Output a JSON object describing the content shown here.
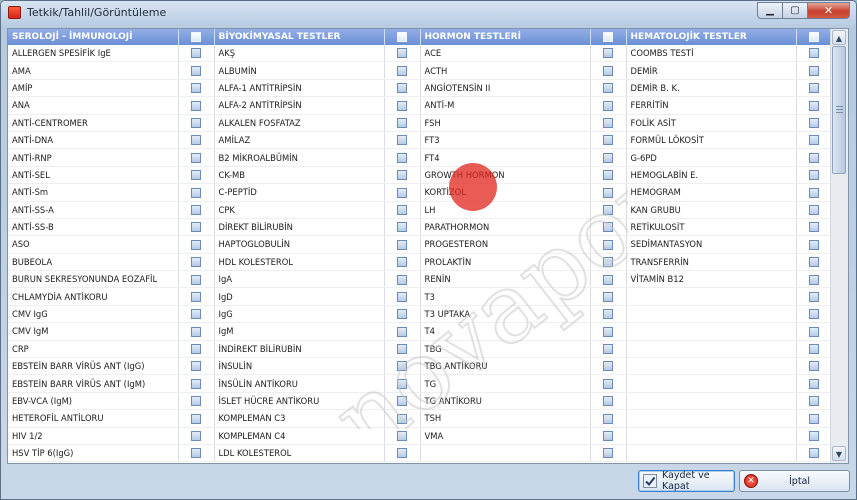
{
  "window": {
    "title": "Tetkik/Tahlil/Görüntüleme"
  },
  "columns": [
    {
      "header": "SEROLOJİ - İMMUNOLOJİ"
    },
    {
      "header": "BİYOKİMYASAL TESTLER"
    },
    {
      "header": "HORMON TESTLERİ"
    },
    {
      "header": "HEMATOLOJİK TESTLER"
    }
  ],
  "rows": [
    [
      "ALLERGEN SPESİFİK IgE",
      "AKŞ",
      "ACE",
      "COOMBS TESTİ"
    ],
    [
      "AMA",
      "ALBUMİN",
      "ACTH",
      "DEMİR"
    ],
    [
      "AMİP",
      "ALFA-1 ANTİTRİPSİN",
      "ANGİOTENSİN II",
      "DEMİR B. K."
    ],
    [
      "ANA",
      "ALFA-2 ANTİTRİPSİN",
      "ANTİ-M",
      "FERRİTİN"
    ],
    [
      "ANTİ-CENTROMER",
      "ALKALEN FOSFATAZ",
      "FSH",
      "FOLİK ASİT"
    ],
    [
      "ANTİ-DNA",
      "AMİLAZ",
      "FT3",
      "FORMÜL LÖKOSİT"
    ],
    [
      "ANTİ-RNP",
      "B2 MİKROALBÜMİN",
      "FT4",
      "G-6PD"
    ],
    [
      "ANTİ-SEL",
      "CK-MB",
      "GROWTH HORMON",
      "HEMOGLABİN E."
    ],
    [
      "ANTİ-Sm",
      "C-PEPTİD",
      "KORTİZOL",
      "HEMOGRAM"
    ],
    [
      "ANTİ-SS-A",
      "CPK",
      "LH",
      "KAN GRUBU"
    ],
    [
      "ANTİ-SS-B",
      "DİREKT BİLİRUBİN",
      "PARATHORMON",
      "RETİKULOSİT"
    ],
    [
      "ASO",
      "HAPTOGLOBULİN",
      "PROGESTERON",
      "SEDİMANTASYON"
    ],
    [
      "BUBEOLA",
      "HDL KOLESTEROL",
      "PROLAKTİN",
      "TRANSFERRİN"
    ],
    [
      "BURUN SEKRESYONUNDA EOZAFİL",
      "IgA",
      "RENİN",
      "VİTAMİN B12"
    ],
    [
      "CHLAMYDİA ANTİKORU",
      "IgD",
      "T3",
      ""
    ],
    [
      "CMV IgG",
      "IgG",
      "T3 UPTAKA",
      ""
    ],
    [
      "CMV IgM",
      "IgM",
      "T4",
      ""
    ],
    [
      "CRP",
      "İNDİREKT BİLİRUBİN",
      "TBG",
      ""
    ],
    [
      "EBSTEİN BARR VİRÜS ANT (IgG)",
      "İNSULİN",
      "TBG ANTİKORU",
      ""
    ],
    [
      "EBSTEİN BARR VİRÜS ANT (IgM)",
      "İNSÜLİN ANTİKORU",
      "TG",
      ""
    ],
    [
      "EBV-VCA (IgM)",
      "İSLET HÜCRE ANTİKORU",
      "TG ANTİKORU",
      ""
    ],
    [
      "HETEROFİL ANTİLORU",
      "KOMPLEMAN C3",
      "TSH",
      ""
    ],
    [
      "HIV 1/2",
      "KOMPLEMAN C4",
      "VMA",
      ""
    ],
    [
      "HSV TİP 6(IgG)",
      "LDL KOLESTEROL",
      "",
      ""
    ]
  ],
  "buttons": {
    "save": "Kaydet ve Kapat",
    "cancel": "İptal"
  },
  "watermark": {
    "text": "novaportis"
  },
  "icons": {
    "save": "check-icon",
    "cancel": "cancel-icon",
    "scroll_up": "scroll-up-arrow-icon",
    "scroll_down": "scroll-down-arrow-icon"
  },
  "colors": {
    "header_bg": "#7a9bdc",
    "save_border": "#3d7fc4",
    "cancel_icon": "#d4261b",
    "watermark_dot": "#e0261c"
  }
}
